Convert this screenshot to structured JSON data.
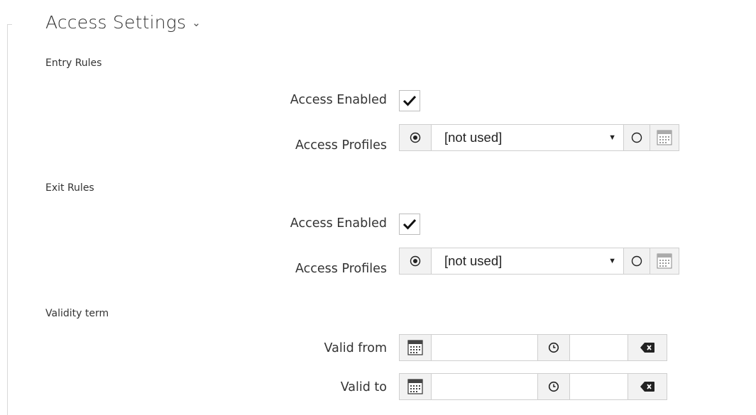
{
  "section": {
    "title": "Access Settings",
    "chevron": "chevron-down-icon"
  },
  "entry_rules": {
    "label": "Entry Rules",
    "access_enabled": {
      "label": "Access Enabled",
      "checked": true
    },
    "access_profiles": {
      "label": "Access Profiles",
      "value": "[not used]",
      "radio_selected": "list"
    }
  },
  "exit_rules": {
    "label": "Exit Rules",
    "access_enabled": {
      "label": "Access Enabled",
      "checked": true
    },
    "access_profiles": {
      "label": "Access Profiles",
      "value": "[not used]",
      "radio_selected": "list"
    }
  },
  "validity_term": {
    "label": "Validity term",
    "valid_from": {
      "label": "Valid from",
      "date": "",
      "time": ""
    },
    "valid_to": {
      "label": "Valid to",
      "date": "",
      "time": ""
    }
  },
  "icons": {
    "calendar": "calendar-icon",
    "clock": "clock-icon",
    "clear": "backspace-clear-icon",
    "check": "checkmark-icon"
  },
  "colors": {
    "text": "#333333",
    "control_bg": "#f2f2f2",
    "border": "#cfcfcf"
  }
}
